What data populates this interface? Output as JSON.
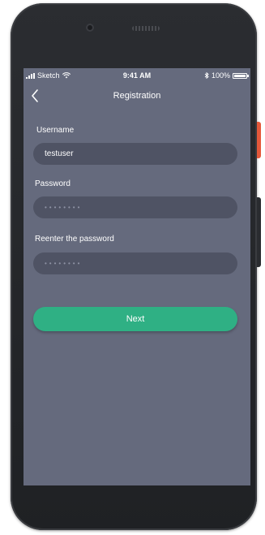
{
  "status_bar": {
    "carrier": "Sketch",
    "time": "9:41 AM",
    "battery": "100%"
  },
  "header": {
    "title": "Registration",
    "back_icon": "chevron-left-icon"
  },
  "form": {
    "username": {
      "label": "Username",
      "value": "testuser"
    },
    "password": {
      "label": "Password",
      "value": "••••••••"
    },
    "confirm_password": {
      "label": "Reenter the password",
      "value": "••••••••"
    }
  },
  "actions": {
    "next_label": "Next"
  },
  "colors": {
    "screen_background": "#656a7d",
    "field_background": "#4f5364",
    "accent": "#2fb084"
  }
}
